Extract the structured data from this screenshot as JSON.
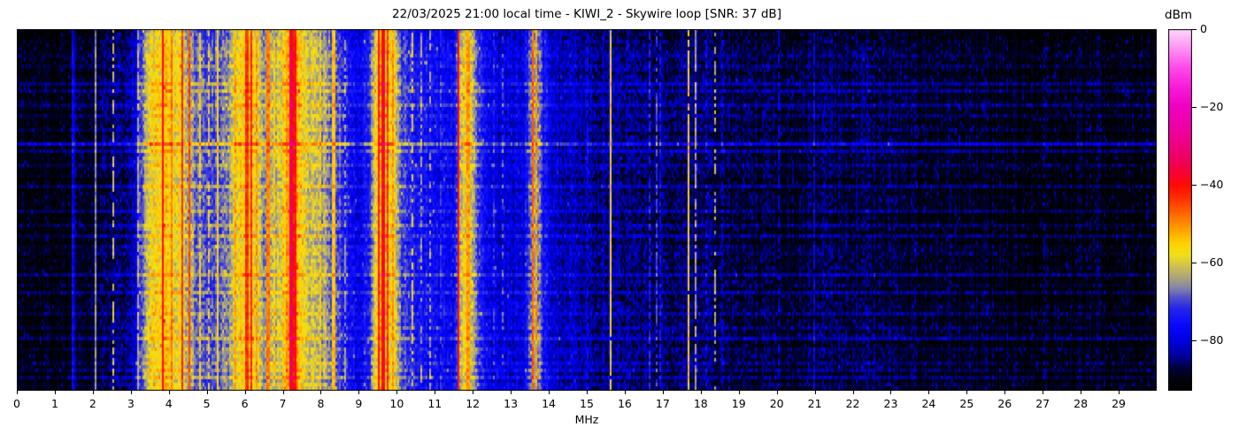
{
  "chart_data": {
    "type": "heatmap",
    "title": "22/03/2025 21:00 local time - KIWI_2 - Skywire loop [SNR: 37 dB]",
    "xlabel": "MHz",
    "x_range": [
      0,
      30
    ],
    "x_ticks": [
      0,
      1,
      2,
      3,
      4,
      5,
      6,
      7,
      8,
      9,
      10,
      11,
      12,
      13,
      14,
      15,
      16,
      17,
      18,
      19,
      20,
      21,
      22,
      23,
      24,
      25,
      26,
      27,
      28,
      29
    ],
    "colorbar": {
      "label": "dBm",
      "range": [
        0,
        -93
      ],
      "ticks": [
        {
          "value": 0,
          "label": "0"
        },
        {
          "value": -20,
          "label": "−20"
        },
        {
          "value": -40,
          "label": "−40"
        },
        {
          "value": -60,
          "label": "−60"
        },
        {
          "value": -80,
          "label": "−80"
        }
      ]
    },
    "colormap_stops": [
      [
        -93,
        "#000000"
      ],
      [
        -90,
        "#02020e"
      ],
      [
        -87,
        "#000042"
      ],
      [
        -84,
        "#0000a0"
      ],
      [
        -80,
        "#0000e0"
      ],
      [
        -76,
        "#0909ff"
      ],
      [
        -72,
        "#2424ea"
      ],
      [
        -69,
        "#5252c8"
      ],
      [
        -66.5,
        "#8686a8"
      ],
      [
        -64,
        "#aaa37a"
      ],
      [
        -61,
        "#cfc050"
      ],
      [
        -58,
        "#f0e018"
      ],
      [
        -55,
        "#ffd000"
      ],
      [
        -51,
        "#ff9800"
      ],
      [
        -47,
        "#ff6000"
      ],
      [
        -43,
        "#ff2800"
      ],
      [
        -40,
        "#ff0a06"
      ],
      [
        -35,
        "#f2004e"
      ],
      [
        -30,
        "#ee0080"
      ],
      [
        -25,
        "#ee00a6"
      ],
      [
        -20,
        "#ee00c0"
      ],
      [
        -15,
        "#f81ad8"
      ],
      [
        -10,
        "#ff48e8"
      ],
      [
        -5,
        "#ff8ff2"
      ],
      [
        0,
        "#fdd7fb"
      ]
    ],
    "spectrum_profile": [
      [
        0,
        -91
      ],
      [
        1.4,
        -91
      ],
      [
        1.55,
        -89
      ],
      [
        2.3,
        -89
      ],
      [
        2.45,
        -86
      ],
      [
        2.65,
        -84
      ],
      [
        2.85,
        -87
      ],
      [
        3.0,
        -85
      ],
      [
        3.15,
        -78
      ],
      [
        3.35,
        -66
      ],
      [
        3.5,
        -60
      ],
      [
        3.7,
        -57
      ],
      [
        3.95,
        -56
      ],
      [
        4.15,
        -58
      ],
      [
        4.35,
        -60
      ],
      [
        4.55,
        -65
      ],
      [
        4.75,
        -68
      ],
      [
        5.0,
        -71
      ],
      [
        5.3,
        -69
      ],
      [
        5.55,
        -67
      ],
      [
        5.7,
        -62
      ],
      [
        5.9,
        -57
      ],
      [
        6.05,
        -56
      ],
      [
        6.2,
        -57
      ],
      [
        6.35,
        -62
      ],
      [
        6.55,
        -66
      ],
      [
        6.75,
        -63
      ],
      [
        6.95,
        -60
      ],
      [
        7.1,
        -53
      ],
      [
        7.25,
        -49
      ],
      [
        7.4,
        -54
      ],
      [
        7.55,
        -60
      ],
      [
        7.75,
        -62
      ],
      [
        8.0,
        -64
      ],
      [
        8.2,
        -66
      ],
      [
        8.45,
        -71
      ],
      [
        8.65,
        -75
      ],
      [
        8.9,
        -78
      ],
      [
        9.1,
        -79
      ],
      [
        9.3,
        -72
      ],
      [
        9.42,
        -61
      ],
      [
        9.55,
        -55
      ],
      [
        9.68,
        -54
      ],
      [
        9.82,
        -57
      ],
      [
        9.95,
        -61
      ],
      [
        10.1,
        -70
      ],
      [
        10.35,
        -74
      ],
      [
        10.65,
        -76
      ],
      [
        11.0,
        -77
      ],
      [
        11.3,
        -79
      ],
      [
        11.5,
        -78
      ],
      [
        11.62,
        -66
      ],
      [
        11.75,
        -60
      ],
      [
        11.9,
        -59
      ],
      [
        12.05,
        -64
      ],
      [
        12.2,
        -74
      ],
      [
        12.45,
        -79
      ],
      [
        12.75,
        -81
      ],
      [
        13.05,
        -81
      ],
      [
        13.35,
        -80
      ],
      [
        13.5,
        -70
      ],
      [
        13.6,
        -64
      ],
      [
        13.72,
        -66
      ],
      [
        13.85,
        -75
      ],
      [
        14.1,
        -81
      ],
      [
        14.45,
        -83
      ],
      [
        14.85,
        -84
      ],
      [
        15.3,
        -85
      ],
      [
        15.8,
        -85
      ],
      [
        16.3,
        -86
      ],
      [
        16.8,
        -86
      ],
      [
        17.3,
        -87
      ],
      [
        17.8,
        -86
      ],
      [
        18.3,
        -87
      ],
      [
        18.7,
        -88
      ],
      [
        19.2,
        -89
      ],
      [
        19.7,
        -89
      ],
      [
        20.3,
        -89
      ],
      [
        20.9,
        -88
      ],
      [
        21.5,
        -88
      ],
      [
        22.2,
        -88
      ],
      [
        22.8,
        -88
      ],
      [
        23.4,
        -89
      ],
      [
        24.0,
        -90
      ],
      [
        25.0,
        -90
      ],
      [
        26.0,
        -91
      ],
      [
        28.0,
        -91
      ],
      [
        30.0,
        -91
      ]
    ],
    "carriers": [
      [
        1.46,
        -78,
        0.025,
        1
      ],
      [
        1.51,
        -82,
        0.02,
        1
      ],
      [
        2.07,
        -66,
        0.02,
        1
      ],
      [
        2.42,
        -68,
        0.02,
        1
      ],
      [
        2.55,
        -62,
        0.03,
        0.55
      ],
      [
        3.2,
        -64,
        0.03,
        0.8
      ],
      [
        3.84,
        -40,
        0.035,
        1
      ],
      [
        4.07,
        -50,
        0.025,
        1
      ],
      [
        4.37,
        -44,
        0.025,
        1
      ],
      [
        4.53,
        -46,
        0.025,
        1
      ],
      [
        4.8,
        -58,
        0.025,
        0.8
      ],
      [
        5.06,
        -60,
        0.025,
        0.7
      ],
      [
        5.3,
        -58,
        0.03,
        1
      ],
      [
        5.75,
        -53,
        0.025,
        1
      ],
      [
        6.06,
        -44,
        0.03,
        1
      ],
      [
        6.17,
        -43,
        0.03,
        1
      ],
      [
        6.3,
        -52,
        0.025,
        1
      ],
      [
        6.62,
        -50,
        0.03,
        1
      ],
      [
        6.79,
        -56,
        0.025,
        0.8
      ],
      [
        7.22,
        -36,
        0.055,
        1
      ],
      [
        7.33,
        -41,
        0.04,
        1
      ],
      [
        7.6,
        -57,
        0.025,
        0.8
      ],
      [
        7.85,
        -58,
        0.025,
        0.7
      ],
      [
        8.0,
        -56,
        0.025,
        0.8
      ],
      [
        8.35,
        -55,
        0.04,
        1
      ],
      [
        8.65,
        -65,
        0.02,
        0.6
      ],
      [
        8.9,
        -68,
        0.02,
        0.6
      ],
      [
        9.52,
        -42,
        0.03,
        1
      ],
      [
        9.64,
        -39,
        0.03,
        1
      ],
      [
        9.77,
        -44,
        0.03,
        1
      ],
      [
        9.9,
        -52,
        0.025,
        1
      ],
      [
        10.0,
        -57,
        0.025,
        0.9
      ],
      [
        10.4,
        -60,
        0.025,
        0.6
      ],
      [
        10.66,
        -64,
        0.02,
        0.5
      ],
      [
        10.87,
        -64,
        0.02,
        0.5
      ],
      [
        11.15,
        -72,
        0.02,
        0.7
      ],
      [
        11.62,
        -39,
        0.025,
        1
      ],
      [
        11.76,
        -54,
        0.025,
        1
      ],
      [
        11.88,
        -52,
        0.03,
        1
      ],
      [
        12.3,
        -70,
        0.02,
        0.35
      ],
      [
        12.55,
        -72,
        0.02,
        0.4
      ],
      [
        12.8,
        -70,
        0.02,
        0.4
      ],
      [
        13.57,
        -48,
        0.03,
        1
      ],
      [
        13.68,
        -52,
        0.03,
        1
      ],
      [
        14.0,
        -77,
        0.02,
        0.7
      ],
      [
        14.22,
        -79,
        0.02,
        0.6
      ],
      [
        14.45,
        -78,
        0.02,
        0.6
      ],
      [
        15.04,
        -78,
        0.02,
        0.6
      ],
      [
        15.64,
        -58,
        0.022,
        0.95
      ],
      [
        15.83,
        -80,
        0.02,
        0.6
      ],
      [
        16.04,
        -79,
        0.02,
        0.6
      ],
      [
        16.3,
        -81,
        0.02,
        0.5
      ],
      [
        16.65,
        -74,
        0.025,
        0.7
      ],
      [
        16.85,
        -71,
        0.025,
        0.7
      ],
      [
        16.95,
        -76,
        0.02,
        0.6
      ],
      [
        17.66,
        -57,
        0.022,
        0.95
      ],
      [
        17.85,
        -64,
        0.022,
        0.8
      ],
      [
        18.13,
        -78,
        0.02,
        0.5
      ],
      [
        18.37,
        -63,
        0.022,
        0.45
      ],
      [
        18.55,
        -80,
        0.02,
        0.5
      ],
      [
        19.75,
        -80,
        0.02,
        0.6
      ],
      [
        20.06,
        -80,
        0.02,
        0.6
      ],
      [
        21.0,
        -78,
        0.025,
        0.7
      ],
      [
        23.06,
        -84,
        0.02,
        0.6
      ],
      [
        27.03,
        -85,
        0.02,
        0.5
      ]
    ],
    "row_streaks": [
      [
        0.0,
        -2
      ],
      [
        0.07,
        3
      ],
      [
        0.1,
        2
      ],
      [
        0.145,
        4
      ],
      [
        0.165,
        5
      ],
      [
        0.205,
        4
      ],
      [
        0.24,
        3
      ],
      [
        0.275,
        2
      ],
      [
        0.315,
        9
      ],
      [
        0.33,
        5
      ],
      [
        0.375,
        3
      ],
      [
        0.43,
        4
      ],
      [
        0.465,
        2
      ],
      [
        0.5,
        3
      ],
      [
        0.535,
        4
      ],
      [
        0.565,
        3
      ],
      [
        0.6,
        2
      ],
      [
        0.62,
        3
      ],
      [
        0.655,
        2
      ],
      [
        0.68,
        4
      ],
      [
        0.71,
        2
      ],
      [
        0.73,
        3
      ],
      [
        0.765,
        2
      ],
      [
        0.78,
        3
      ],
      [
        0.82,
        2
      ],
      [
        0.85,
        4
      ],
      [
        0.88,
        2
      ],
      [
        0.92,
        3
      ],
      [
        0.945,
        2
      ],
      [
        0.965,
        3
      ]
    ],
    "texture": {
      "cols": 644,
      "rows": 102,
      "seed": 1337,
      "noise_db": 8,
      "dark_threshold": -88,
      "speckle_prob": 0.22,
      "spike_prob": 0.05
    }
  }
}
